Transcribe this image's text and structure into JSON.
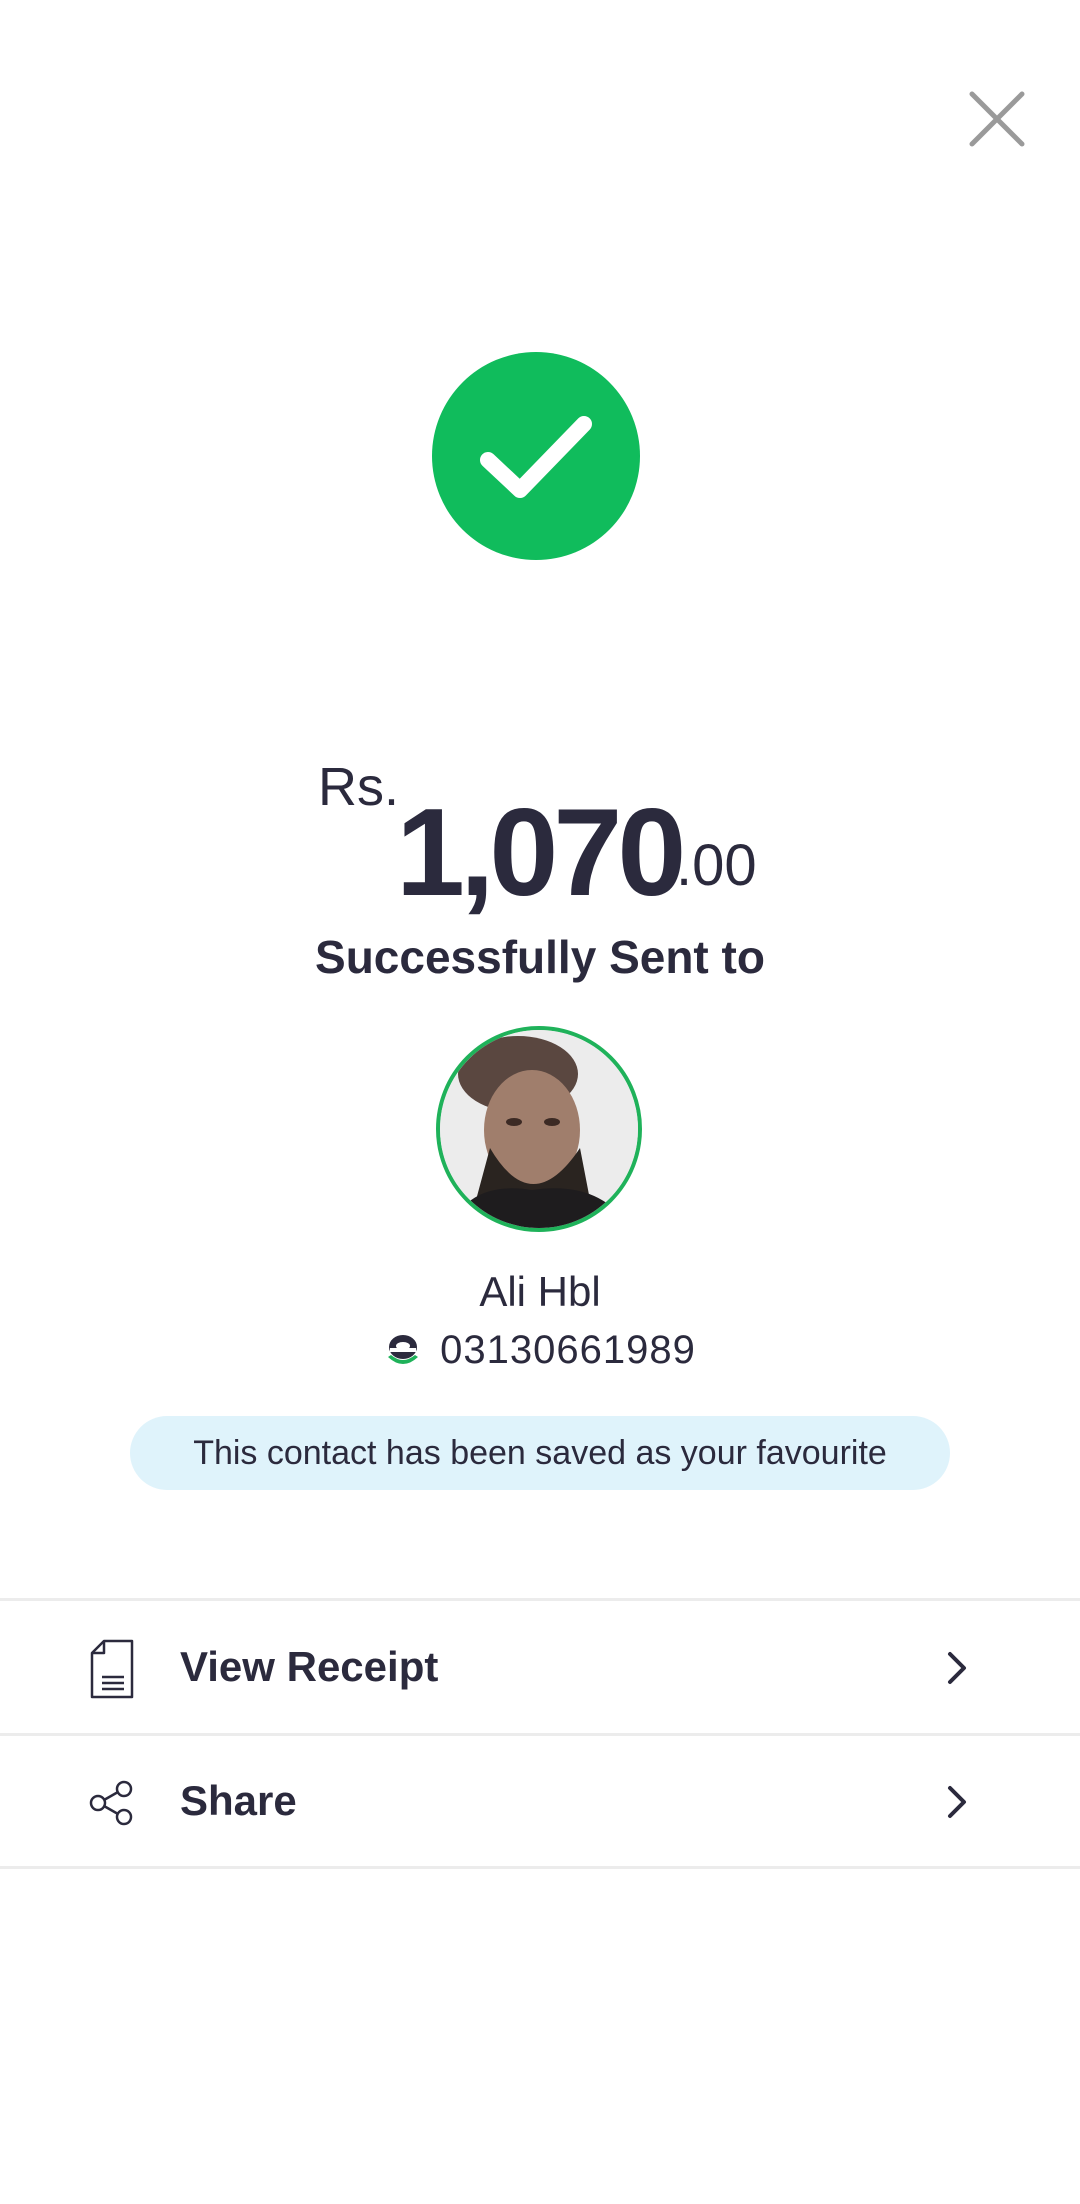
{
  "header": {
    "close_icon": "close-icon"
  },
  "status": {
    "icon": "check-circle-icon",
    "color": "#10bc5c"
  },
  "amount": {
    "currency": "Rs.",
    "whole": "1,070",
    "decimal": ".00"
  },
  "message": "Successfully Sent to",
  "recipient": {
    "name": "Ali Hbl",
    "wallet_icon": "easypaisa-icon",
    "phone": "03130661989",
    "avatar_border": "#1fb25a"
  },
  "favourite_banner": "This contact has been saved as your favourite",
  "actions": [
    {
      "label": "View Receipt",
      "icon": "receipt-icon"
    },
    {
      "label": "Share",
      "icon": "share-icon"
    }
  ]
}
